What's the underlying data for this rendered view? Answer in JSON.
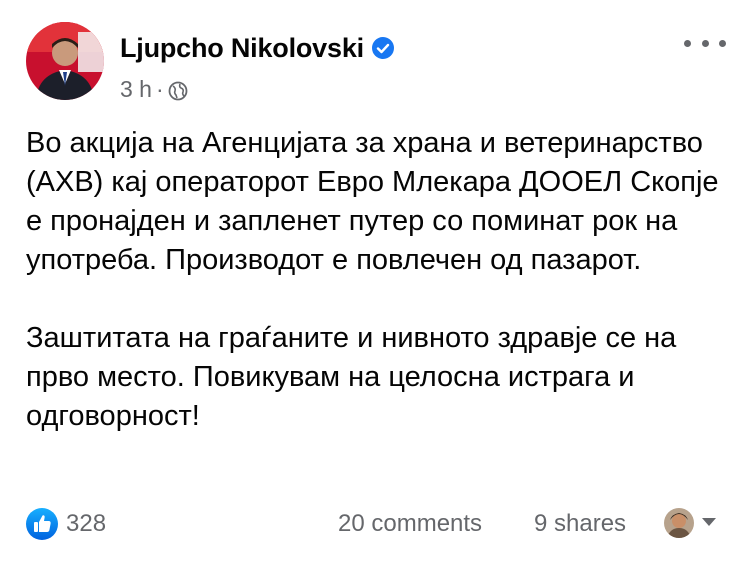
{
  "post": {
    "author": "Ljupcho Nikolovski",
    "verified_icon": "verified-badge-icon",
    "time": "3 h",
    "separator": "·",
    "privacy_icon": "globe-icon",
    "more_icon": "more-options-icon",
    "paragraphs": [
      "Во акција на Агенцијата за храна и ветеринарство (АХВ) кај операторот Евро Млекара ДООЕЛ Скопје е пронајден и запленет путер со поминат рок на употреба. Производот е повлечен од пазарот.",
      "Заштитата на граѓаните и нивното здравје се на прво место. Повикувам на целосна истрага и одговорност!"
    ]
  },
  "footer": {
    "like_icon": "like-reaction-icon",
    "reactions_count": "328",
    "comments": "20 comments",
    "shares": "9 shares",
    "dropdown_icon": "caret-down-icon"
  },
  "colors": {
    "accent": "#1877f2",
    "text": "#050505",
    "secondary": "#65676b"
  }
}
